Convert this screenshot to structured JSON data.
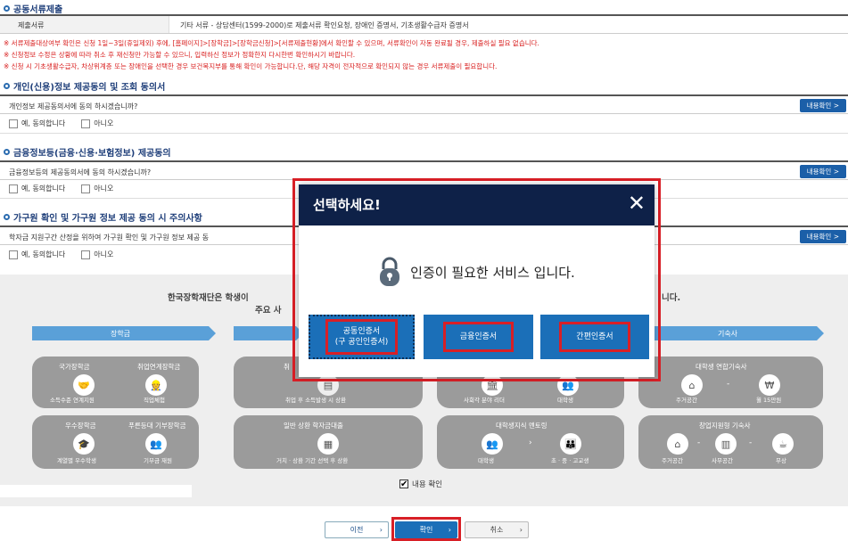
{
  "doc_section": {
    "title": "공동서류제출",
    "table_header": "제출서류",
    "table_value": "기타 서류 - 상담센터(1599-2000)로 제출서류 확인요청, 장애인 증명서, 기초생활수급자 증명서",
    "notes": [
      "※ 서류제출대상여부 확인은 신청 1일~3일(휴일제외) 후에, [홈페이지]>[장학금]>[장학금신청]>[서류제출현황]에서 확인할 수 있으며, 서류확인이 자동 완료될 경우, 제출하실 필요 없습니다.",
      "※ 신청정보 수정은 상황에 따라 취소 후 재신청만 가능할 수 있으니, 입력하신 정보가 정확한지 다시한번 확인하시기 바랍니다.",
      "※ 신청 시 기초생활수급자, 차상위계층 또는 장애인을 선택한 경우 보건복지부를 통해 확인이 가능합니다.단, 해당 자격이 전자적으로 확인되지 않는 경우 서류제출이 필요합니다."
    ]
  },
  "consents": [
    {
      "title": "개인(신용)정보 제공동의 및 조회 동의서",
      "question": "개인정보 제공동의서에 동의 하시겠습니까?",
      "view_label": "내용확인 >",
      "yes": "예, 동의합니다",
      "no": "아니오"
    },
    {
      "title": "금융정보등(금융·신용·보험정보) 제공동의",
      "question": "금융정보등의 제공동의서에 동의 하시겠습니까?",
      "view_label": "내용확인 >",
      "yes": "예, 동의합니다",
      "no": "아니오"
    },
    {
      "title": "가구원 확인 및 가구원 정보 제공 동의 시 주의사항",
      "question": "학자금 지원구간 산정을 위하여 가구원 확인 및 가구원 정보 제공 동",
      "view_label": "내용확인 >",
      "yes": "예, 동의합니다",
      "no": "아니오"
    }
  ],
  "info": {
    "intro_line1": "한국장학재단은 학생이",
    "intro_line1_end": "니다.",
    "intro_line2": "주요 사",
    "arrows": [
      "장학금",
      "",
      "",
      "기숙사"
    ],
    "cards": [
      {
        "title": "국가장학금",
        "label": "소득수준 연계지원"
      },
      {
        "title": "취업연계장학금",
        "label": "직업체험"
      },
      {
        "title": "우수장학금",
        "label": "계열별 우수학생"
      },
      {
        "title": "푸른등대 기부장학금",
        "label": "기부금 재원"
      },
      {
        "title": "취",
        "label": "취업 후 소득발생 시 상환"
      },
      {
        "title": "일반 상환 학자금대출",
        "label": "거치 · 상환 기간 선택 후 상환"
      },
      {
        "title": "",
        "label": "사회각 분야 리더"
      },
      {
        "title": "",
        "label": "대학생"
      },
      {
        "title": "대학생지식 멘토링",
        "label": "대학생"
      },
      {
        "title": "",
        "label": "초 · 중 · 고교생"
      },
      {
        "title": "대학생 연합기숙사",
        "label": "주거공간"
      },
      {
        "title": "",
        "label": "월 15만원"
      },
      {
        "title": "창업지원형 기숙사",
        "label": "주거공간"
      },
      {
        "title": "",
        "label": "사무공간"
      },
      {
        "title": "",
        "label": "무상"
      }
    ],
    "confirm_label": "내용 확인"
  },
  "footer": {
    "prev": "이전",
    "ok": "확인",
    "cancel": "취소"
  },
  "modal": {
    "title": "선택하세요!",
    "message": "인증이 필요한 서비스 입니다.",
    "buttons": [
      {
        "line1": "공동인증서",
        "line2": "(구 공인인증서)"
      },
      {
        "line1": "금융인증서",
        "line2": ""
      },
      {
        "line1": "간편인증서",
        "line2": ""
      }
    ]
  },
  "colors": {
    "accent": "#1b6fb8",
    "highlight": "#d81f26",
    "modal_header": "#0e2148",
    "warning_text": "#d92020"
  }
}
